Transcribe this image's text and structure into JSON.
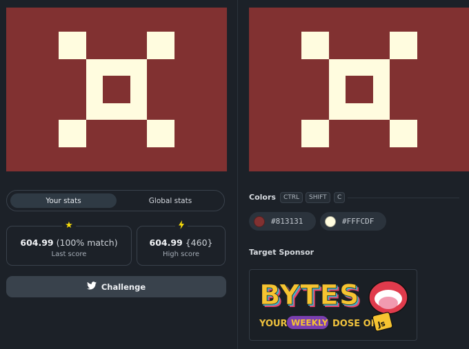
{
  "stats": {
    "tabs": [
      {
        "label": "Your stats",
        "active": true
      },
      {
        "label": "Global stats",
        "active": false
      }
    ],
    "last_score": {
      "value": "604.99",
      "detail": "(100% match)",
      "caption": "Last score",
      "icon": "star-icon"
    },
    "high_score": {
      "value": "604.99",
      "detail": "{460}",
      "caption": "High score",
      "icon": "lightning-icon"
    }
  },
  "challenge": {
    "label": "Challenge",
    "icon": "twitter-icon"
  },
  "colors": {
    "title": "Colors",
    "shortcut": [
      "CTRL",
      "SHIFT",
      "C"
    ],
    "swatches": [
      {
        "hex": "#813131"
      },
      {
        "hex": "#FFFCDF"
      }
    ]
  },
  "sponsor": {
    "title": "Target Sponsor",
    "logo_text": "BYTES",
    "tagline_prefix": "YOUR",
    "tagline_highlight": "WEEKLY",
    "tagline_suffix": "DOSE OF",
    "badge": "JS"
  },
  "palette": {
    "background": "#813131",
    "foreground": "#FFFCDF",
    "app_bg": "#1c2128"
  }
}
